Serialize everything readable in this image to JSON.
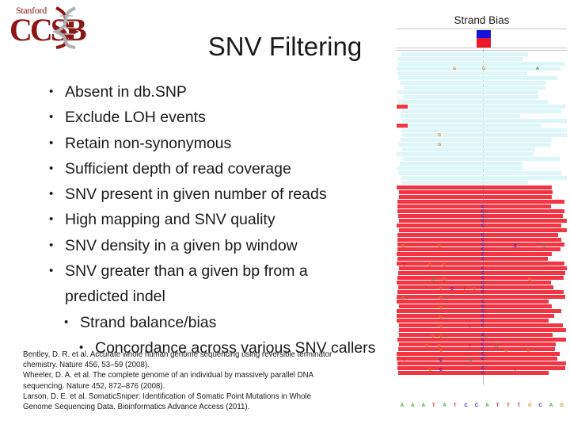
{
  "logo": {
    "org": "Stanford",
    "acronym": "CCSB",
    "helix_icon": "dna-helix-icon",
    "brand_color": "#8c1515"
  },
  "slide": {
    "title": "SNV Filtering"
  },
  "bullets": [
    {
      "text": "Absent in db.SNP",
      "level": 0
    },
    {
      "text": "Exclude LOH events",
      "level": 0
    },
    {
      "text": "Retain non-synonymous",
      "level": 0
    },
    {
      "text": "Sufficient depth of read coverage",
      "level": 0
    },
    {
      "text": "SNV present in given number of reads",
      "level": 0
    },
    {
      "text": "High mapping and SNV quality",
      "level": 0
    },
    {
      "text": "SNV density in a given bp window",
      "level": 0
    },
    {
      "text": "SNV greater than a given bp from a",
      "level": 0,
      "continuation": "predicted indel"
    },
    {
      "text": "Strand balance/bias",
      "level": 1
    },
    {
      "text": "Concordance across various SNV callers",
      "level": 2
    }
  ],
  "references": [
    "Bentley, D. R. et al. Accurate whole human genome sequencing using reversible terminator",
    "chemistry. Nature 456, 53–59 (2008).",
    "Wheeler, D. A. et al. The complete genome of an individual by massively parallel DNA",
    "sequencing. Nature 452, 872–876 (2008).",
    "Larson, D. E. et al. SomaticSniper: Identification of Somatic Point Mutations in Whole",
    "Genome Sequencing Data. Bioinformatics Advance Access (2011)."
  ],
  "igv": {
    "title": "Strand Bias",
    "coverage_bar": {
      "ref_allele_color": "#e8192c",
      "alt_allele_color": "#1415d8"
    },
    "colors": {
      "forward_read": "#ddf6f7",
      "reverse_read": "#f23542",
      "center_line": "#9fc8d4",
      "base_A": "#2ea02e",
      "base_C": "#2b28c8",
      "base_G": "#d98a26",
      "base_T": "#d62b2b"
    },
    "reference_sequence": [
      "A",
      "A",
      "A",
      "T",
      "A",
      "T",
      "C",
      "C",
      "A",
      "T",
      "T",
      "T",
      "G",
      "C",
      "A",
      "G"
    ],
    "snv_column_base": "C"
  }
}
